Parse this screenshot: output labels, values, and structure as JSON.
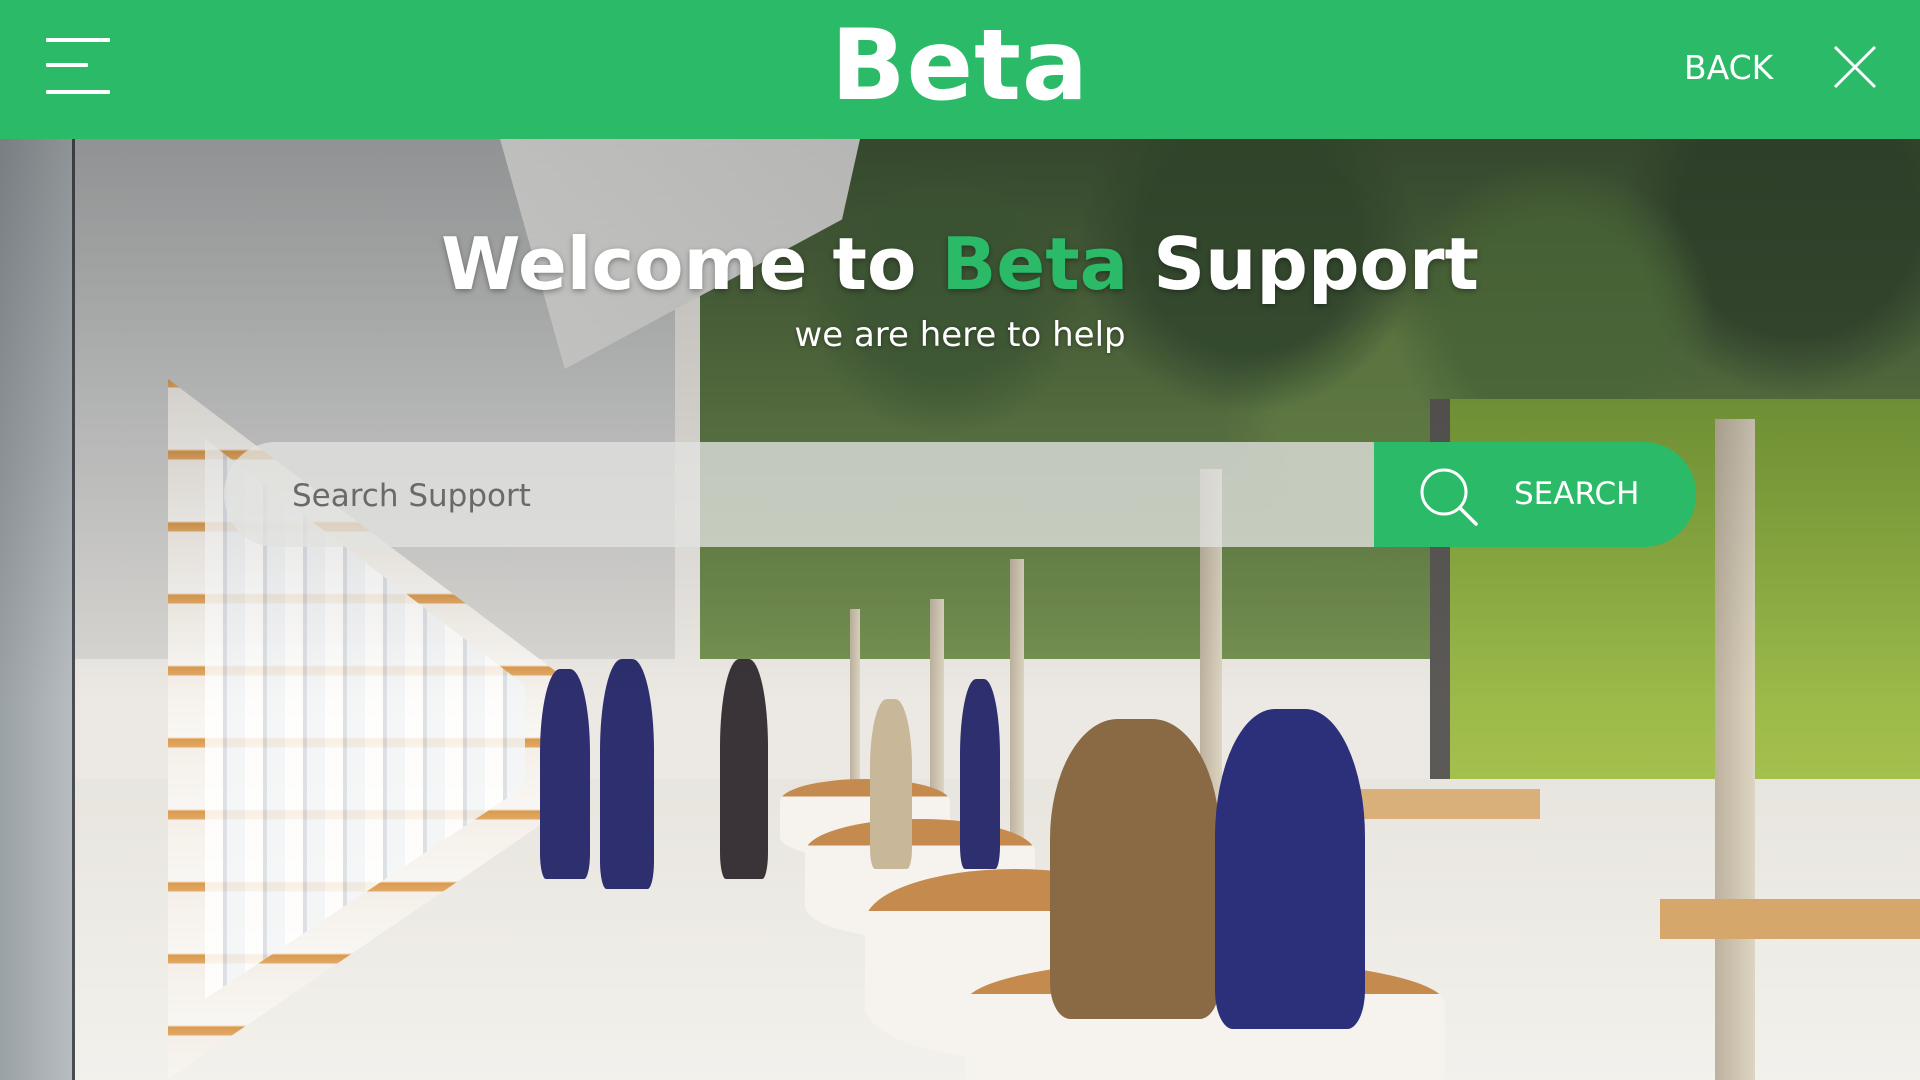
{
  "header": {
    "menu_icon": "hamburger-menu-icon",
    "brand": "Beta",
    "back_label": "BACK",
    "close_icon": "close-icon",
    "background_color": "#2bba67"
  },
  "hero": {
    "welcome_prefix": "Welcome to",
    "welcome_brand": "Beta",
    "welcome_suffix": "Support",
    "tagline": "we are here to help",
    "accent_color": "#2bba67"
  },
  "search": {
    "placeholder": "Search Support",
    "value": "",
    "button_label": "SEARCH",
    "button_icon": "search-icon"
  }
}
